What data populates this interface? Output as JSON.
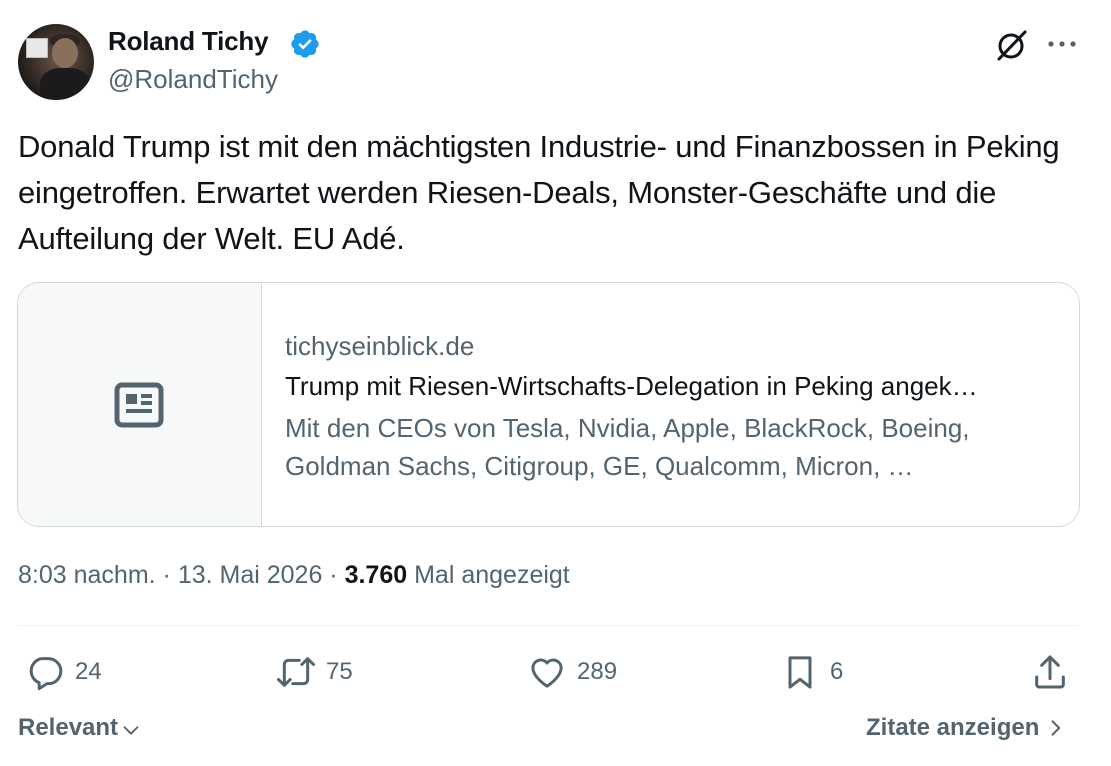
{
  "author": {
    "display_name": "Roland Tichy",
    "handle": "@RolandTichy",
    "verified_color": "#1d9bf0"
  },
  "tweet": {
    "text": "Donald Trump ist mit den mächtigsten Industrie- und Finanzbossen in Peking eingetroffen. Erwartet werden Riesen-Deals, Monster-Geschäfte und die Aufteilung der Welt. EU Adé."
  },
  "card": {
    "icon": "news-icon",
    "domain": "tichyseinblick.de",
    "title": "Trump mit Riesen-Wirtschafts-Delegation in Peking angek…",
    "description": "Mit den CEOs von Tesla, Nvidia, Apple, BlackRock, Boeing, Goldman Sachs, Citigroup, GE, Qualcomm, Micron, …"
  },
  "meta": {
    "time": "8:03 nachm.",
    "date": "13. Mai 2026",
    "views_count": "3.760",
    "views_label": "Mal angezeigt",
    "separator": " · "
  },
  "actions": {
    "replies": "24",
    "reposts": "75",
    "likes": "289",
    "bookmarks": "6"
  },
  "footer": {
    "sort_label": "Relevant",
    "quotes_label": "Zitate anzeigen"
  },
  "colors": {
    "text": "#0f1419",
    "secondary": "#536471",
    "border": "#cfd9de",
    "accent": "#1d9bf0"
  }
}
